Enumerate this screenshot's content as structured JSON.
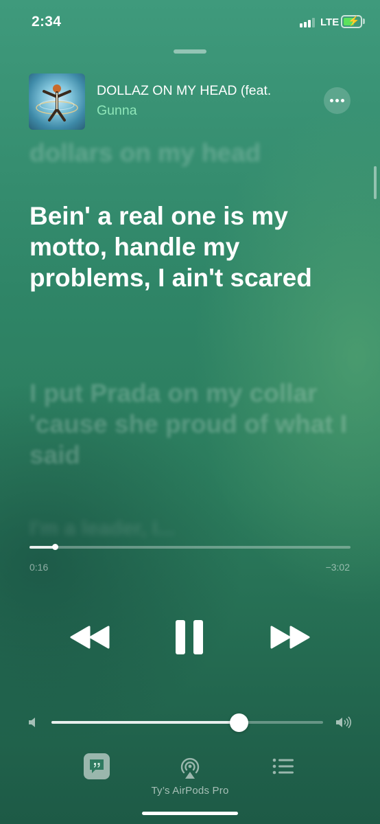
{
  "status_bar": {
    "time": "2:34",
    "network": "LTE",
    "signal_bars": 4,
    "signal_bars_filled": 3,
    "battery_level": 0.6,
    "battery_charging": true,
    "battery_color": "#5ce15c"
  },
  "now_playing": {
    "title": "DOLLAZ ON MY HEAD (feat.",
    "artist": "Gunna",
    "artist_color": "#8fe6b9",
    "artwork_icon": "album-artwork",
    "more_icon": "ellipsis-icon"
  },
  "lyrics": {
    "previous": "dollars on my head",
    "current": "Bein' a real one is my motto, handle my problems, I ain't scared",
    "next": "I put Prada on my collar 'cause she proud of what I said",
    "next2": "I'm a leader, I..."
  },
  "playback": {
    "elapsed": "0:16",
    "remaining": "−3:02",
    "progress": 0.081
  },
  "controls": {
    "previous_icon": "rewind-icon",
    "pause_icon": "pause-icon",
    "next_icon": "fast-forward-icon"
  },
  "volume": {
    "level": 0.69,
    "low_icon": "volume-low-icon",
    "high_icon": "volume-high-icon"
  },
  "bottom_bar": {
    "lyrics_icon": "lyrics-quote-icon",
    "airplay_icon": "airplay-icon",
    "airplay_device": "Ty’s AirPods Pro",
    "queue_icon": "queue-list-icon"
  },
  "colors": {
    "background_top": "#3f9a7c",
    "background_bottom": "#1d5a46",
    "accent": "#8fe6b9"
  }
}
